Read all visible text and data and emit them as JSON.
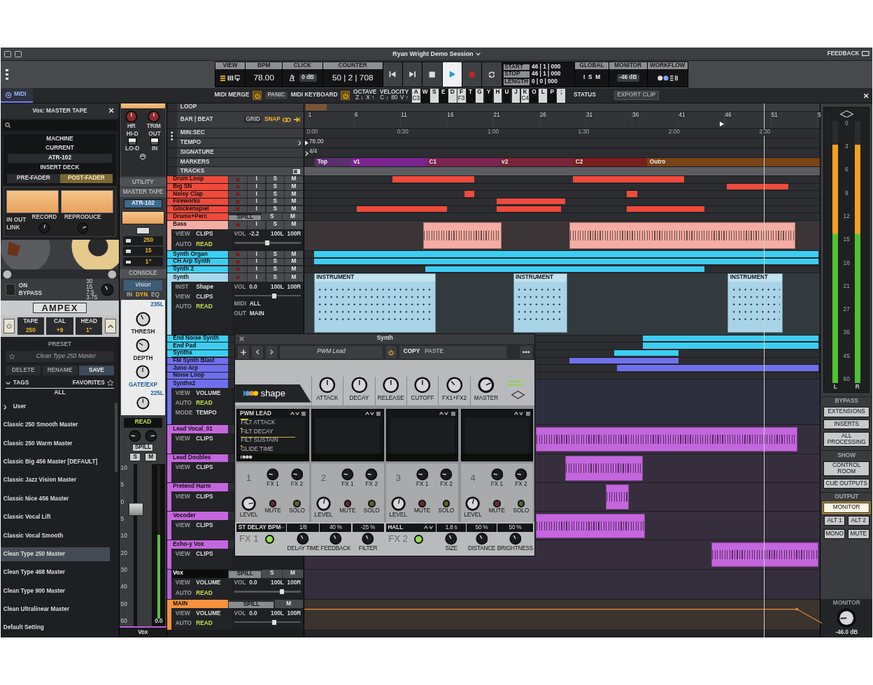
{
  "window": {
    "title": "Ryan Wright Demo Session",
    "feedback": "FEEDBACK"
  },
  "transport": {
    "view_label": "VIEW",
    "bpm_label": "BPM",
    "bpm": "78.00",
    "click_label": "CLICK",
    "click_level": "0 dB",
    "counter_label": "COUNTER",
    "counter": "50 | 2 | 708",
    "buttons": [
      {
        "kind": "rewind",
        "selected": false
      },
      {
        "kind": "forward",
        "selected": false
      },
      {
        "kind": "stop",
        "selected": false
      },
      {
        "kind": "play",
        "selected": true
      },
      {
        "kind": "record",
        "selected": false
      },
      {
        "kind": "loop",
        "selected": false
      }
    ],
    "locators": [
      {
        "label": "START",
        "value": "46 | 1 | 000"
      },
      {
        "label": "STOP",
        "value": "46 | 1 | 000"
      },
      {
        "label": "LENGTH",
        "value": "0 | 0 | 000"
      }
    ],
    "global_label": "GLOBAL",
    "global_keys": [
      "I",
      "S",
      "M"
    ],
    "monitor_label": "MONITOR",
    "monitor_level": "-46 dB",
    "workflow_label": "WORKFLOW"
  },
  "midi_bar": {
    "tab": "MIDI",
    "merge": "MIDI MERGE",
    "merge_on": true,
    "panic": "PANIC",
    "keyboard": "MIDI KEYBOARD",
    "keyboard_on": true,
    "octave_label": "OCTAVE",
    "octave_keys": [
      "Z ↓",
      "X ↑"
    ],
    "velocity_label": "VELOCITY",
    "velocity_keys": [
      "C ↓",
      "80",
      "V ↑"
    ],
    "keys": [
      {
        "key": "A",
        "note": "C3",
        "kind": "white"
      },
      {
        "key": "W",
        "kind": "black"
      },
      {
        "key": "S",
        "kind": "white"
      },
      {
        "key": "E",
        "kind": "black"
      },
      {
        "key": "D",
        "kind": "white"
      },
      {
        "key": "F",
        "note": "F3",
        "kind": "white"
      },
      {
        "key": "T",
        "kind": "black"
      },
      {
        "key": "G",
        "kind": "white"
      },
      {
        "key": "Y",
        "kind": "black"
      },
      {
        "key": "H",
        "kind": "white"
      },
      {
        "key": "U",
        "kind": "black"
      },
      {
        "key": "J",
        "kind": "white"
      },
      {
        "key": "K",
        "note": "C4",
        "kind": "white"
      },
      {
        "key": "O",
        "kind": "black"
      },
      {
        "key": "L",
        "kind": "white"
      },
      {
        "key": "P",
        "kind": "black"
      },
      {
        "key": ";",
        "kind": "white"
      }
    ],
    "status": "STATUS",
    "export": "EXPORT CLIP"
  },
  "plugin_panel": {
    "title": "Vox: MASTER TAPE",
    "machine": "MACHINE",
    "current": "CURRENT",
    "machine_value": "ATR-102",
    "insert_deck": "INSERT DECK",
    "deck_options": [
      {
        "label": "PRE-FADER",
        "selected": false
      },
      {
        "label": "POST-FADER",
        "selected": true
      }
    ],
    "meter_labels": [
      "RECORD",
      "REPRODUCE"
    ],
    "in": "IN",
    "out": "OUT",
    "link": "LINK",
    "on": "ON",
    "bypass": "BYPASS",
    "bypass_on": false,
    "speeds": [
      "30",
      "15",
      "7.5",
      "3.75"
    ],
    "brand": "AMPEX",
    "tape_controls": [
      {
        "label": "TAPE",
        "value": "250"
      },
      {
        "label": "CAL",
        "value": "+9"
      },
      {
        "label": "HEAD",
        "value": "1\""
      }
    ],
    "preset_label": "PRESET",
    "preset": "Clean Type 250 Master",
    "actions": [
      "DELETE",
      "RENAME",
      "SAVE"
    ],
    "tags": "TAGS",
    "favorites": "FAVORITES",
    "all": "ALL",
    "folder": "User",
    "presets": [
      {
        "name": "Classic 250 Smooth Master",
        "selected": false
      },
      {
        "name": "Classic 250 Warm Master",
        "selected": false
      },
      {
        "name": "Classic Big 456 Master [DEFAULT]",
        "selected": false
      },
      {
        "name": "Classic Jazz Vision Master",
        "selected": false
      },
      {
        "name": "Classic Nice 456 Master",
        "selected": false
      },
      {
        "name": "Classic Vocal Lift",
        "selected": false
      },
      {
        "name": "Classic Vocal Smooth",
        "selected": false
      },
      {
        "name": "Clean Type 250 Master",
        "selected": true
      },
      {
        "name": "Clean Type 468 Master",
        "selected": false
      },
      {
        "name": "Clean Type 900 Master",
        "selected": false
      },
      {
        "name": "Clean Ultralinear Master",
        "selected": false
      },
      {
        "name": "Default Setting",
        "selected": false
      }
    ]
  },
  "channel_strip": {
    "knobs": [
      "HR",
      "TRIM"
    ],
    "switches": [
      {
        "top": "HI-D",
        "bottom": "LO-D",
        "on": true
      },
      {
        "top": "OUT",
        "bottom": "IN",
        "on": true
      }
    ],
    "utility": "UTILITY",
    "insert": "MASTER TAPE",
    "insert_machine": "ATR-102",
    "values": [
      "250",
      "15",
      "1\""
    ],
    "console": "CONSOLE",
    "console_plugin": "Vision",
    "modes": [
      {
        "label": "IN",
        "selected": false
      },
      {
        "label": "DYN",
        "selected": true
      },
      {
        "label": "EQ",
        "selected": false
      }
    ],
    "models": [
      "235L",
      "225L"
    ],
    "dyn_labels": [
      "THRESH",
      "DEPTH",
      "GATE/EXP"
    ],
    "automation": "READ",
    "spill": "SPILL",
    "solo": "S",
    "mute": "M",
    "fader": {
      "level": 0.72
    },
    "scale": [
      "10",
      "5",
      "0",
      "5",
      "10",
      "20",
      "30",
      "40",
      "50",
      "60"
    ],
    "meter": {
      "level": 0.55
    },
    "reading": "0.0",
    "name": "Vox"
  },
  "ruler": {
    "rows": [
      "LOOP",
      "BAR | BEAT",
      "MIN:SEC",
      "TEMPO",
      "SIGNATURE",
      "MARKERS",
      "TRACKS"
    ],
    "grid": "GRID",
    "snap": "SNAP",
    "bars": [
      "1",
      "6",
      "11",
      "16",
      "21",
      "26",
      "31",
      "36",
      "41",
      "46",
      "51",
      "5"
    ],
    "times": [
      "0:00",
      "0:30",
      "1:00",
      "1:30",
      "2:00",
      "2:30"
    ],
    "tempo": "78.00",
    "signature": "4/4",
    "markers": [
      {
        "label": "Top",
        "color": "#5c2f6e"
      },
      {
        "label": "v1",
        "color": "#7a2590"
      },
      {
        "label": "C1",
        "color": "#7c2552"
      },
      {
        "label": "v2",
        "color": "#7a2438"
      },
      {
        "label": "C2",
        "color": "#7a1f1f"
      },
      {
        "label": "Outro",
        "color": "#7a4318"
      }
    ]
  },
  "tracks": [
    {
      "name": "Drum Loop",
      "color": "#f04a3c",
      "expanded": false,
      "selected": false,
      "buttons": [
        {
          "kind": "record"
        },
        {
          "kind": "input",
          "label": "I"
        },
        {
          "kind": "solo",
          "label": "S"
        },
        {
          "kind": "mute",
          "label": "M"
        }
      ]
    },
    {
      "name": "Big SN",
      "color": "#f04a3c",
      "expanded": false,
      "selected": false,
      "buttons": [
        {
          "kind": "record"
        },
        {
          "kind": "input",
          "label": "I"
        },
        {
          "kind": "solo",
          "label": "S"
        },
        {
          "kind": "mute",
          "label": "M"
        }
      ]
    },
    {
      "name": "Noisy Clap",
      "color": "#f04a3c",
      "expanded": false,
      "selected": false,
      "buttons": [
        {
          "kind": "record"
        },
        {
          "kind": "input",
          "label": "I"
        },
        {
          "kind": "solo",
          "label": "S"
        },
        {
          "kind": "mute",
          "label": "M"
        }
      ]
    },
    {
      "name": "Fireworks",
      "color": "#f04a3c",
      "expanded": false,
      "selected": false,
      "buttons": [
        {
          "kind": "record"
        },
        {
          "kind": "input",
          "label": "I"
        },
        {
          "kind": "solo",
          "label": "S"
        },
        {
          "kind": "mute",
          "label": "M"
        }
      ]
    },
    {
      "name": "Glockenspiel",
      "color": "#f04a3c",
      "expanded": false,
      "selected": false,
      "buttons": [
        {
          "kind": "record"
        },
        {
          "kind": "input",
          "label": "I"
        },
        {
          "kind": "solo",
          "label": "S"
        },
        {
          "kind": "mute",
          "label": "M"
        }
      ]
    },
    {
      "name": "Drums+Perc",
      "color": "#f04a3c",
      "expanded": false,
      "selected": false,
      "buttons": [
        {
          "kind": "spill",
          "label": "SPILL"
        },
        {
          "kind": "solo",
          "label": "S"
        },
        {
          "kind": "mute",
          "label": "M"
        }
      ]
    },
    {
      "name": "Bass",
      "color": "#f4aca3",
      "expanded": true,
      "selected": false,
      "buttons": [
        {
          "kind": "record"
        },
        {
          "kind": "input",
          "label": "I"
        },
        {
          "kind": "solo",
          "label": "S"
        },
        {
          "kind": "mute",
          "label": "M"
        }
      ],
      "fields": [
        {
          "kind": "view",
          "label": "VIEW",
          "value": "CLIPS"
        },
        {
          "kind": "automation",
          "label": "AUTO",
          "value": "READ"
        }
      ],
      "mixer": {
        "vol_label": "VOL",
        "vol": "-2.2",
        "pan_left": "100L",
        "pan_right": "100R",
        "level": 0.5
      }
    },
    {
      "name": "Synth Organ",
      "color": "#3dcdf2",
      "expanded": false,
      "selected": false,
      "buttons": [
        {
          "kind": "record"
        },
        {
          "kind": "input",
          "label": "I"
        },
        {
          "kind": "solo",
          "label": "S"
        },
        {
          "kind": "mute",
          "label": "M"
        }
      ]
    },
    {
      "name": "CH Arp Synth",
      "color": "#3dcdf2",
      "expanded": false,
      "selected": false,
      "buttons": [
        {
          "kind": "record"
        },
        {
          "kind": "input",
          "label": "I"
        },
        {
          "kind": "solo",
          "label": "S"
        },
        {
          "kind": "mute",
          "label": "M"
        }
      ]
    },
    {
      "name": "Synth 2",
      "color": "#3dcdf2",
      "expanded": false,
      "selected": false,
      "buttons": [
        {
          "kind": "record"
        },
        {
          "kind": "input",
          "label": "I"
        },
        {
          "kind": "solo",
          "label": "S"
        },
        {
          "kind": "mute",
          "label": "M"
        }
      ]
    },
    {
      "name": "Synth",
      "color": "#a8d7eb",
      "expanded": true,
      "selected": false,
      "buttons": [
        {
          "kind": "record"
        },
        {
          "kind": "input",
          "label": "I"
        },
        {
          "kind": "solo",
          "label": "S"
        },
        {
          "kind": "mute",
          "label": "M"
        }
      ],
      "fields": [
        {
          "kind": "instrument",
          "label": "INST",
          "value": "Shape"
        },
        {
          "kind": "view",
          "label": "VIEW",
          "value": "CLIPS"
        },
        {
          "kind": "automation",
          "label": "AUTO",
          "value": "READ"
        }
      ],
      "mixer": {
        "vol_label": "VOL",
        "vol": "0.0",
        "pan_left": "100L",
        "pan_right": "100R",
        "level": 0.6,
        "routing": [
          {
            "label": "MIDI",
            "value": "ALL"
          },
          {
            "label": "OUT",
            "value": "MAIN"
          }
        ]
      },
      "clips": [
        {
          "label": "INSTRUMENT"
        },
        {
          "label": "INSTRUMENT"
        },
        {
          "label": "INSTRUMENT"
        }
      ]
    },
    {
      "name": "End Noise Synth",
      "color": "#3dcdf2",
      "expanded": false,
      "selected": false
    },
    {
      "name": "End Pad",
      "color": "#3dcdf2",
      "expanded": false,
      "selected": false
    },
    {
      "name": "Synths",
      "color": "#3dcdf2",
      "expanded": false,
      "selected": false
    },
    {
      "name": "FM Synth Blast",
      "color": "#7070ee",
      "expanded": false,
      "selected": false
    },
    {
      "name": "Juno Arp",
      "color": "#7070ee",
      "expanded": false,
      "selected": false
    },
    {
      "name": "Noise Loop",
      "color": "#7070ee",
      "expanded": false,
      "selected": false
    },
    {
      "name": "Synths2",
      "color": "#7070ee",
      "expanded": true,
      "selected": false,
      "fields": [
        {
          "kind": "view",
          "label": "VIEW",
          "value": "VOLUME"
        },
        {
          "kind": "automation",
          "label": "AUTO",
          "value": "READ"
        },
        {
          "kind": "mode",
          "label": "MODE",
          "value": "TEMPO"
        }
      ]
    },
    {
      "name": "Lead Vocal_01",
      "color": "#c466de",
      "expanded": true,
      "selected": false,
      "fields": [
        {
          "kind": "view",
          "label": "VIEW",
          "value": "CLIPS"
        }
      ]
    },
    {
      "name": "Lead Doubles",
      "color": "#c466de",
      "expanded": true,
      "selected": false,
      "fields": [
        {
          "kind": "view",
          "label": "VIEW",
          "value": "CLIPS"
        }
      ]
    },
    {
      "name": "Pretend Harm",
      "color": "#c466de",
      "expanded": true,
      "selected": false,
      "fields": [
        {
          "kind": "view",
          "label": "VIEW",
          "value": "CLIPS"
        }
      ]
    },
    {
      "name": "Vocoder",
      "color": "#c466de",
      "expanded": true,
      "selected": false,
      "fields": [
        {
          "kind": "view",
          "label": "VIEW",
          "value": "CLIPS"
        }
      ]
    },
    {
      "name": "Echo-y Vox",
      "color": "#c466de",
      "expanded": true,
      "selected": false,
      "fields": [
        {
          "kind": "view",
          "label": "VIEW",
          "value": "CLIPS"
        }
      ]
    },
    {
      "name": "Vox",
      "color": "#b65fd6",
      "expanded": true,
      "selected": true,
      "buttons": [
        {
          "kind": "spill",
          "label": "SPILL"
        },
        {
          "kind": "solo",
          "label": "S"
        },
        {
          "kind": "mute",
          "label": "M"
        }
      ],
      "fields": [
        {
          "kind": "view",
          "label": "VIEW",
          "value": "VOLUME"
        },
        {
          "kind": "automation",
          "label": "AUTO",
          "value": "READ"
        }
      ],
      "mixer": {
        "vol_label": "VOL",
        "vol": "0.0",
        "pan_left": "100L",
        "pan_right": "100R",
        "level": 0.72
      }
    },
    {
      "name": "MAIN",
      "color": "#f5923e",
      "expanded": true,
      "selected": false,
      "buttons": [
        {
          "kind": "spill",
          "label": "SPILL"
        },
        {
          "kind": "mute",
          "label": "M"
        }
      ],
      "fields": [
        {
          "kind": "view",
          "label": "VIEW",
          "value": "VOLUME"
        },
        {
          "kind": "automation",
          "label": "AUTO",
          "value": "READ"
        }
      ],
      "mixer": {
        "vol_label": "VOL",
        "vol": "0.0",
        "pan_left": "100L",
        "pan_right": "100R",
        "level": 0.6
      }
    }
  ],
  "synth_window": {
    "title": "Synth",
    "preset": "PWM Lead",
    "power_on": true,
    "copy": "COPY",
    "paste": "PASTE",
    "logo": "shape",
    "macros": [
      "ATTACK",
      "DECAY",
      "RELEASE",
      "CUTOFF",
      "FX1+FX2",
      "MASTER"
    ],
    "slots": [
      {
        "number": "1",
        "preset": "PWM LEAD",
        "params": [
          {
            "name": "FILT ATTACK",
            "level": 0.12
          },
          {
            "name": "FILT DECAY",
            "level": 0.02
          },
          {
            "name": "FILT SUSTAIN",
            "level": 0.85
          },
          {
            "name": "GLIDE TIME",
            "level": 0.02
          }
        ],
        "fx_labels": [
          "FX 1",
          "FX 2"
        ],
        "level_label": "LEVEL",
        "mute": "MUTE",
        "solo": "SOLO"
      },
      {
        "number": "2",
        "fx_labels": [
          "FX 1",
          "FX 2"
        ],
        "level_label": "LEVEL",
        "mute": "MUTE",
        "solo": "SOLO"
      },
      {
        "number": "3",
        "fx_labels": [
          "FX 1",
          "FX 2"
        ],
        "level_label": "LEVEL",
        "mute": "MUTE",
        "solo": "SOLO"
      },
      {
        "number": "4",
        "fx_labels": [
          "FX 1",
          "FX 2"
        ],
        "level_label": "LEVEL",
        "mute": "MUTE",
        "solo": "SOLO"
      }
    ],
    "effects": [
      {
        "name": "FX 1",
        "type": "ST DELAY BPM",
        "on": true,
        "params": [
          {
            "value": "1/8",
            "label": "DELAY TIME"
          },
          {
            "value": "40 %",
            "label": "FEEDBACK"
          },
          {
            "value": "-25 %",
            "label": "FILTER"
          }
        ]
      },
      {
        "name": "FX 2",
        "type": "HALL",
        "on": true,
        "params": [
          {
            "value": "1.8 s",
            "label": "SIZE"
          },
          {
            "value": "50 %",
            "label": "DISTANCE"
          },
          {
            "value": "50 %",
            "label": "BRIGHTNESS"
          }
        ]
      }
    ]
  },
  "master_meter": {
    "scale": [
      "0",
      "3",
      "6",
      "9",
      "12",
      "15",
      "18",
      "21",
      "27",
      "36",
      "45",
      "60"
    ],
    "channels": [
      {
        "name": "L",
        "level": 0.91
      },
      {
        "name": "R",
        "level": 0.91
      }
    ],
    "bypass_label": "BYPASS",
    "bypass": [
      "EXTENSIONS",
      "INSERTS",
      "ALL PROCESSING"
    ],
    "show_label": "SHOW",
    "show": [
      "CONTROL ROOM",
      "CUE OUTPUTS"
    ],
    "output_label": "OUTPUT",
    "outputs": [
      {
        "label": "MONITOR",
        "selected": true
      },
      {
        "label": "ALT 1",
        "selected": false
      },
      {
        "label": "ALT 2",
        "selected": false
      },
      {
        "label": "MONO",
        "selected": false
      },
      {
        "label": "MUTE",
        "selected": false
      }
    ],
    "monitor_label": "MONITOR",
    "monitor_reading": "-46.0 dB"
  }
}
